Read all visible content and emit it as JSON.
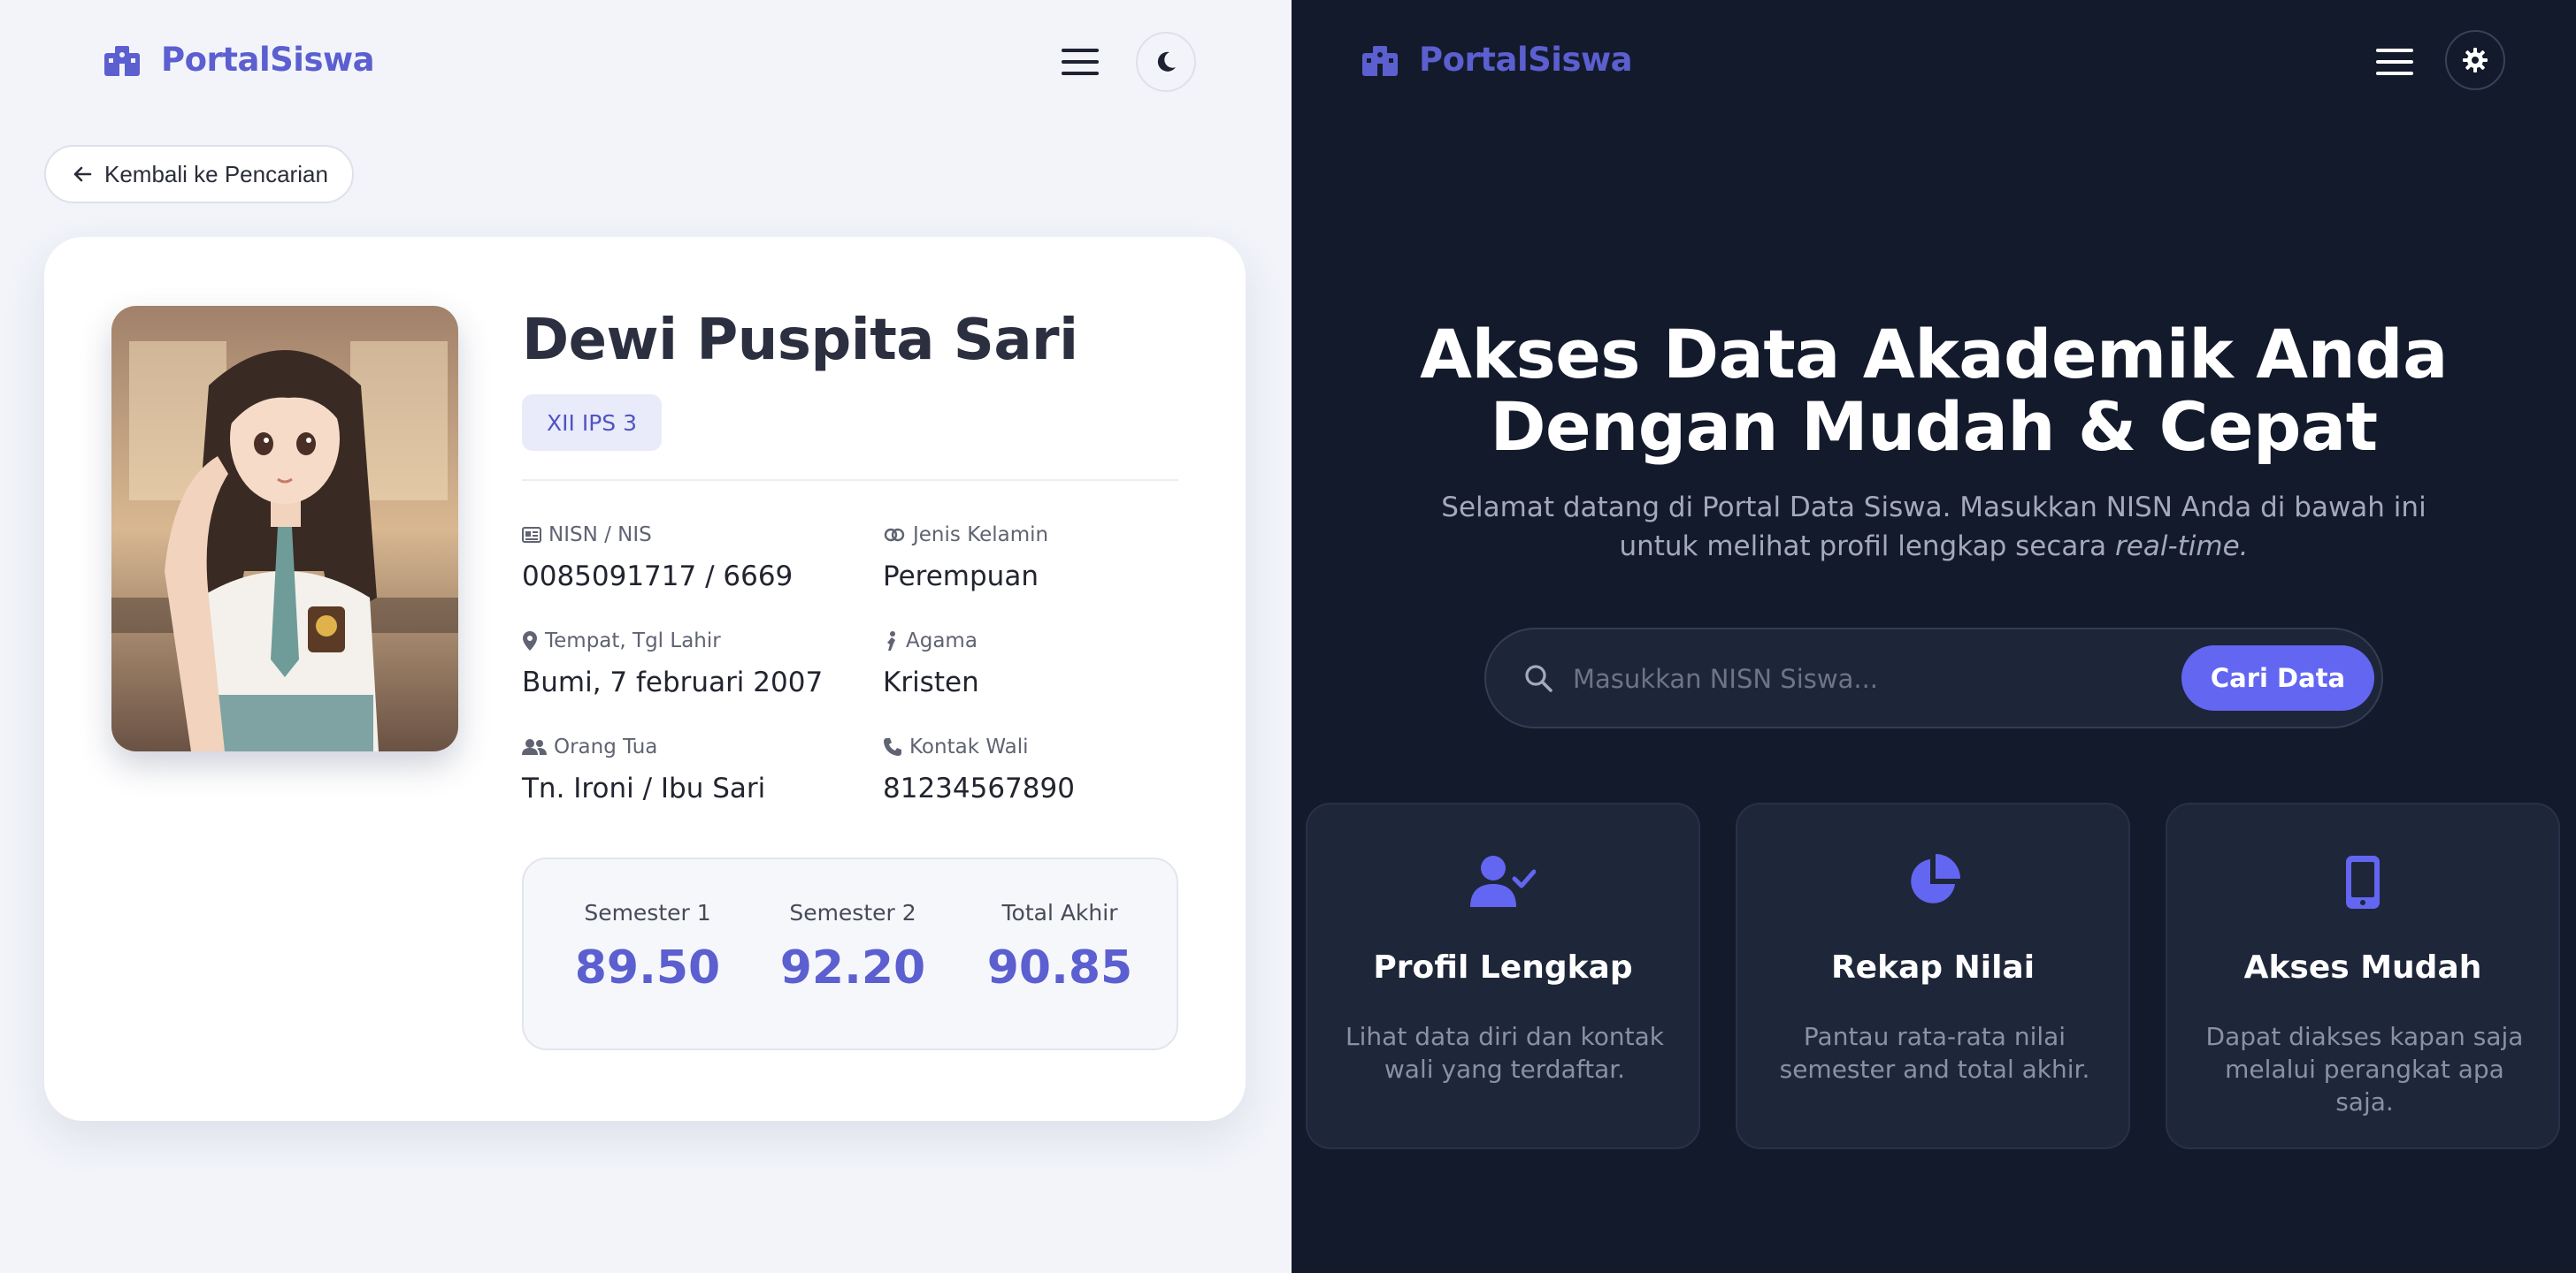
{
  "left": {
    "brand": "PortalSiswa",
    "back_label": "Kembali ke Pencarian",
    "student": {
      "name": "Dewi Puspita Sari",
      "class": "XII IPS 3"
    },
    "fields": [
      {
        "icon": "id-card-icon",
        "label": "NISN / NIS",
        "value": "0085091717 / 6669"
      },
      {
        "icon": "gender-icon",
        "label": "Jenis Kelamin",
        "value": "Perempuan"
      },
      {
        "icon": "location-pin-icon",
        "label": "Tempat, Tgl Lahir",
        "value": "Bumi, 7 februari 2007"
      },
      {
        "icon": "pray-icon",
        "label": "Agama",
        "value": "Kristen"
      },
      {
        "icon": "users-icon",
        "label": "Orang Tua",
        "value": "Tn. Ironi / Ibu Sari"
      },
      {
        "icon": "phone-icon",
        "label": "Kontak Wali",
        "value": "81234567890"
      }
    ],
    "scores": [
      {
        "label": "Semester 1",
        "value": "89.50"
      },
      {
        "label": "Semester 2",
        "value": "92.20"
      },
      {
        "label": "Total Akhir",
        "value": "90.85"
      }
    ]
  },
  "right": {
    "brand": "PortalSiswa",
    "hero": {
      "title_line1": "Akses Data Akademik Anda",
      "title_line2": "Dengan Mudah & Cepat",
      "subtitle_line1": "Selamat datang di Portal Data Siswa. Masukkan NISN Anda di bawah ini",
      "subtitle_line2_prefix": "untuk melihat profil lengkap secara ",
      "subtitle_line2_emphasis": "real-time."
    },
    "search": {
      "placeholder": "Masukkan NISN Siswa...",
      "button_label": "Cari Data"
    },
    "features": [
      {
        "icon": "user-check-icon",
        "title": "Profil Lengkap",
        "desc_line1": "Lihat data diri dan kontak",
        "desc_line2": "wali yang terdaftar."
      },
      {
        "icon": "pie-chart-icon",
        "title": "Rekap Nilai",
        "desc_line1": "Pantau rata-rata nilai",
        "desc_line2": "semester and total akhir."
      },
      {
        "icon": "mobile-icon",
        "title": "Akses Mudah",
        "desc_line1": "Dapat diakses kapan saja",
        "desc_line2": "melalui perangkat apa saja."
      }
    ]
  },
  "colors": {
    "accent": "#6366f1",
    "brand_text": "#5b5fcf",
    "light_bg": "#f2f4fa",
    "dark_bg": "#131a2c",
    "dark_card": "#1e2639"
  }
}
